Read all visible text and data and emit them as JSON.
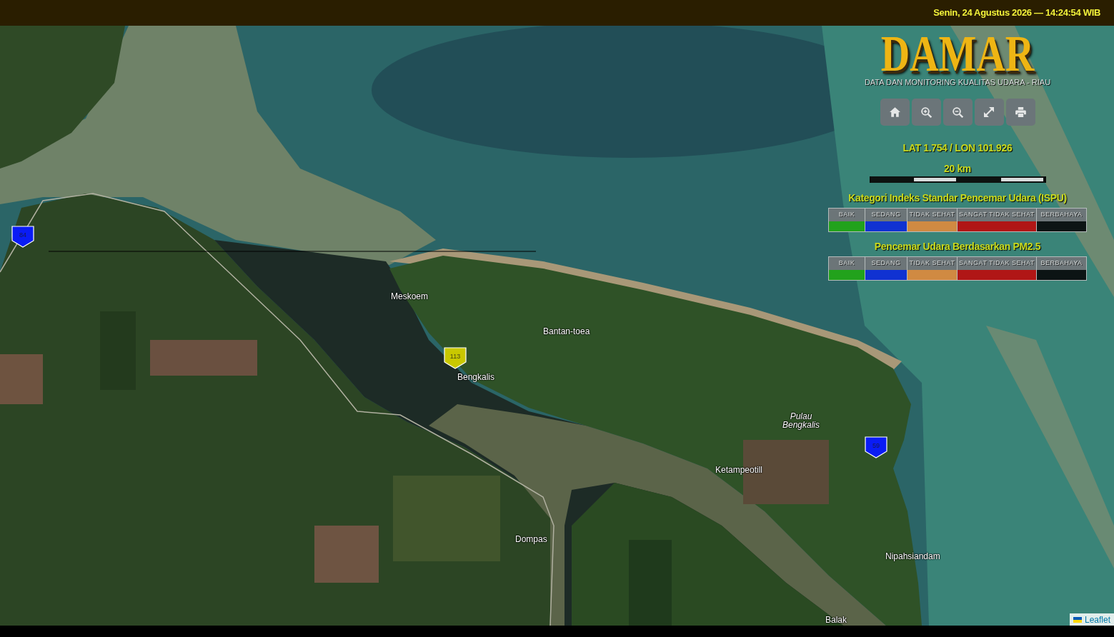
{
  "header": {
    "datetime": "Senin, 24 Agustus 2026 — 14:24:54 WIB"
  },
  "map": {
    "place_labels": [
      {
        "text": "Meskoem",
        "kind": "place"
      },
      {
        "text": "Bantan-toea",
        "kind": "place"
      },
      {
        "text": "Bengkalis",
        "kind": "place"
      },
      {
        "text": "Pulau Bengkalis",
        "kind": "island"
      },
      {
        "text": "Ketampeotill",
        "kind": "place"
      },
      {
        "text": "Dompas",
        "kind": "place"
      },
      {
        "text": "Nipahsiandam",
        "kind": "place"
      },
      {
        "text": "Balak",
        "kind": "place"
      }
    ],
    "markers": [
      {
        "value": "84",
        "color": "#0a1cf5"
      },
      {
        "value": "113",
        "color": "#c9c800"
      },
      {
        "value": "59",
        "color": "#0a1cf5"
      }
    ],
    "attribution": {
      "link": "Leaflet"
    }
  },
  "panel": {
    "logo": "DAMAR",
    "subtitle": "DATA DAN MONITORING KUALITAS UDARA - RIAU",
    "coordinates": "LAT 1.754 / LON 101.926",
    "scale": {
      "label": "20 km"
    },
    "legends": [
      {
        "title": "Kategori Indeks Standar Pencemar Udara (ISPU)",
        "categories": [
          {
            "label": "BAIK",
            "color": "#22a21c"
          },
          {
            "label": "SEDANG",
            "color": "#1032d2"
          },
          {
            "label": "TIDAK SEHAT",
            "color": "#d08a42"
          },
          {
            "label": "SANGAT TIDAK SEHAT",
            "color": "#b01616"
          },
          {
            "label": "BERBAHAYA",
            "color": "#0c1414"
          }
        ]
      },
      {
        "title": "Pencemar Udara Berdasarkan PM2.5",
        "categories": [
          {
            "label": "BAIK",
            "color": "#22a21c"
          },
          {
            "label": "SEDANG",
            "color": "#1032d2"
          },
          {
            "label": "TIDAK SEHAT",
            "color": "#d08a42"
          },
          {
            "label": "SANGAT TIDAK SEHAT",
            "color": "#b01616"
          },
          {
            "label": "BERBAHAYA",
            "color": "#0c1414"
          }
        ]
      }
    ]
  }
}
